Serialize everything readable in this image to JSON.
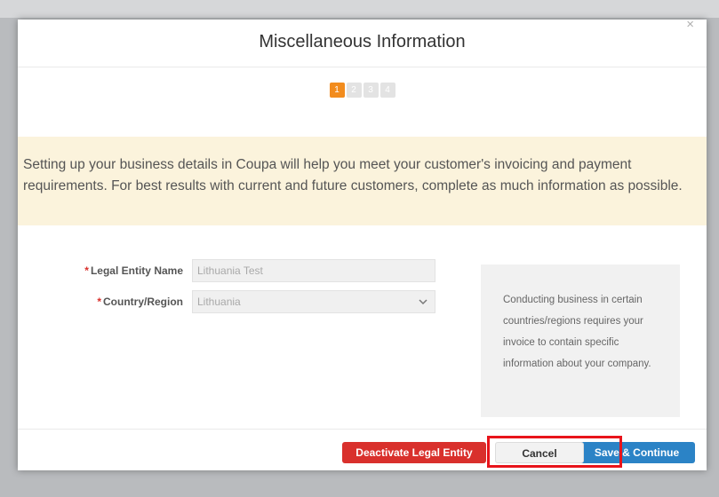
{
  "modal": {
    "title": "Miscellaneous Information",
    "close_glyph": "×",
    "steps": [
      {
        "label": "1",
        "active": true
      },
      {
        "label": "2",
        "active": false
      },
      {
        "label": "3",
        "active": false
      },
      {
        "label": "4",
        "active": false
      }
    ],
    "notice_text": "Setting up your business details in Coupa will help you meet your customer's invoicing and payment requirements. For best results with current and future customers, complete as much information as possible.",
    "form": {
      "required_mark": "*",
      "legal_entity_label": "Legal Entity Name",
      "legal_entity_value": "Lithuania Test",
      "country_label": "Country/Region",
      "country_value": "Lithuania"
    },
    "info_text": "Conducting business in certain countries/regions requires your invoice to contain specific information about your company.",
    "buttons": {
      "deactivate": "Deactivate Legal Entity",
      "cancel": "Cancel",
      "save": "Save & Continue"
    }
  },
  "colors": {
    "accent_orange": "#f28c1e",
    "danger_red": "#d9302c",
    "primary_blue": "#2b83c6",
    "notice_bg": "#fbf3dc",
    "highlight_red": "#e8141b"
  },
  "icons": {
    "close": "close-icon",
    "dropdown": "chevron-down-icon"
  }
}
